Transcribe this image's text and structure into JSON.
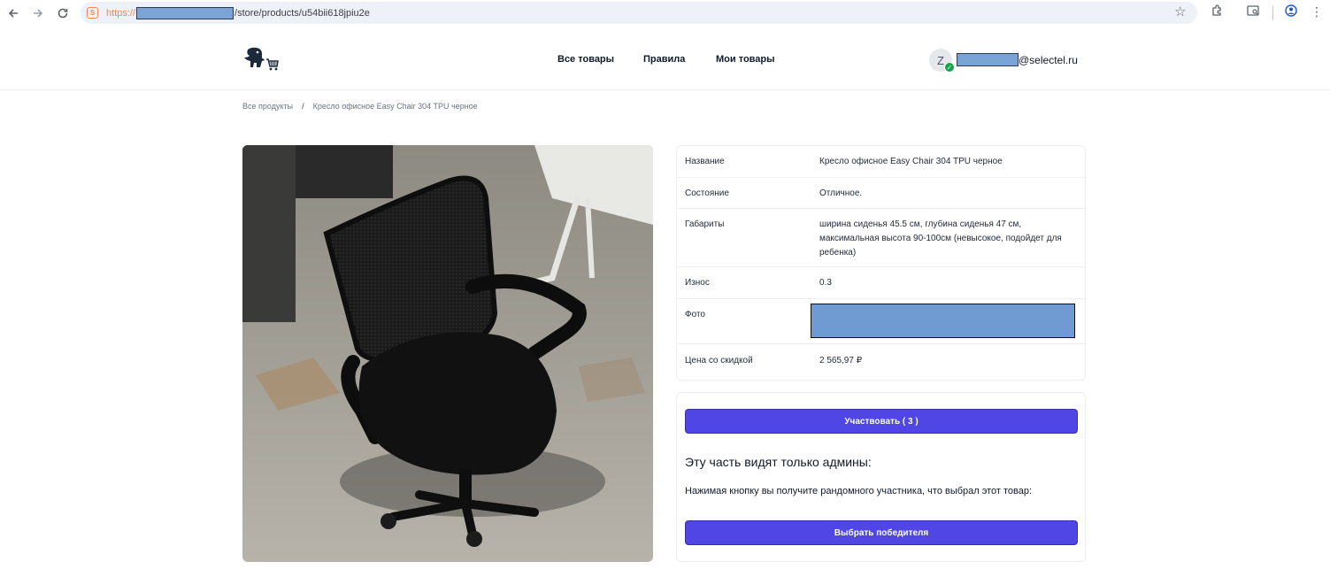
{
  "browser": {
    "url_scheme": "https://",
    "url_path": "/store/products/u54bii618jpiu2e"
  },
  "header": {
    "nav": [
      {
        "label": "Все товары"
      },
      {
        "label": "Правила"
      },
      {
        "label": "Мои товары"
      }
    ],
    "user": {
      "avatar_letter": "Z",
      "email_domain": "@selectel.ru"
    }
  },
  "breadcrumb": {
    "root": "Все продукты",
    "separator": "/",
    "current": "Кресло офисное Easy Chair 304 TPU черное"
  },
  "details": {
    "rows": [
      {
        "key": "Название",
        "value": "Кресло офисное Easy Chair 304 TPU черное"
      },
      {
        "key": "Состояние",
        "value": "Отличное."
      },
      {
        "key": "Габариты",
        "value": "ширина сиденья 45.5 см, глубина сиденья 47 см, максимальная высота 90-100см (невысокое, подойдет для ребенка)"
      },
      {
        "key": "Износ",
        "value": "0.3"
      },
      {
        "key": "Фото",
        "value": ""
      },
      {
        "key": "Цена со скидкой",
        "value": "2 565,97 ₽"
      }
    ]
  },
  "actions": {
    "participate_label": "Участвовать ( 3 )",
    "admin_title": "Эту часть видят только админы:",
    "admin_text": "Нажимая кнопку вы получите рандомного участника, что выбрал этот товар:",
    "pick_winner_label": "Выбрать победителя"
  },
  "colors": {
    "accent": "#4f46e5",
    "status_ok": "#16a34a",
    "url_scheme": "#e8895a"
  },
  "icons": [
    "back-arrow-icon",
    "forward-arrow-icon",
    "reload-icon",
    "site-info-icon",
    "star-icon",
    "extensions-icon",
    "tab-search-icon",
    "profile-icon",
    "kebab-menu-icon",
    "dino-cart-logo-icon",
    "check-icon"
  ]
}
